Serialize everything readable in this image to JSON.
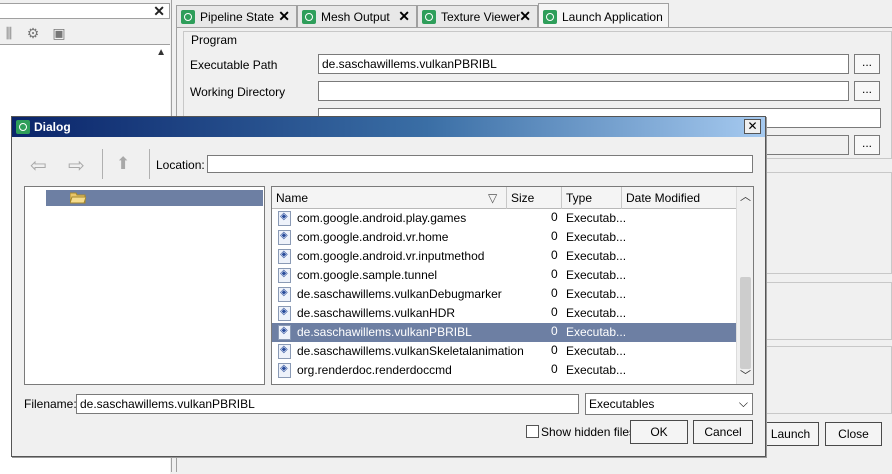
{
  "background": {
    "left_panel": {
      "toolbar_icons": [
        "filter-icon",
        "settings-icon",
        "save-icon"
      ]
    },
    "tabs": [
      {
        "label": "Pipeline State"
      },
      {
        "label": "Mesh Output"
      },
      {
        "label": "Texture Viewer"
      },
      {
        "label": "Launch Application",
        "active": true
      }
    ],
    "program_group": {
      "title": "Program",
      "executable_label": "Executable Path",
      "executable_value": "de.saschawillems.vulkanPBRIBL",
      "working_dir_label": "Working Directory",
      "working_dir_value": "",
      "browse_label": "..."
    },
    "launch_label": "Launch",
    "close_label": "Close"
  },
  "dialog": {
    "title": "Dialog",
    "close_label": "X",
    "location_label": "Location:",
    "location_value": "",
    "columns": {
      "name": "Name",
      "size": "Size",
      "type": "Type",
      "date": "Date Modified"
    },
    "files": [
      {
        "name": "com.google.android.play.games",
        "size": "0",
        "type": "Executab..."
      },
      {
        "name": "com.google.android.vr.home",
        "size": "0",
        "type": "Executab..."
      },
      {
        "name": "com.google.android.vr.inputmethod",
        "size": "0",
        "type": "Executab..."
      },
      {
        "name": "com.google.sample.tunnel",
        "size": "0",
        "type": "Executab..."
      },
      {
        "name": "de.saschawillems.vulkanDebugmarker",
        "size": "0",
        "type": "Executab..."
      },
      {
        "name": "de.saschawillems.vulkanHDR",
        "size": "0",
        "type": "Executab..."
      },
      {
        "name": "de.saschawillems.vulkanPBRIBL",
        "size": "0",
        "type": "Executab...",
        "selected": true
      },
      {
        "name": "de.saschawillems.vulkanSkeletalanimation",
        "size": "0",
        "type": "Executab..."
      },
      {
        "name": "org.renderdoc.renderdoccmd",
        "size": "0",
        "type": "Executab..."
      }
    ],
    "filename_label": "Filename:",
    "filename_value": "de.saschawillems.vulkanPBRIBL",
    "filter_value": "Executables",
    "show_hidden_label": "Show hidden files",
    "show_hidden_checked": false,
    "ok_label": "OK",
    "cancel_label": "Cancel",
    "accent_color": "#6d7fa3",
    "title_gradient": [
      "#0a246a",
      "#a6caf0"
    ]
  }
}
